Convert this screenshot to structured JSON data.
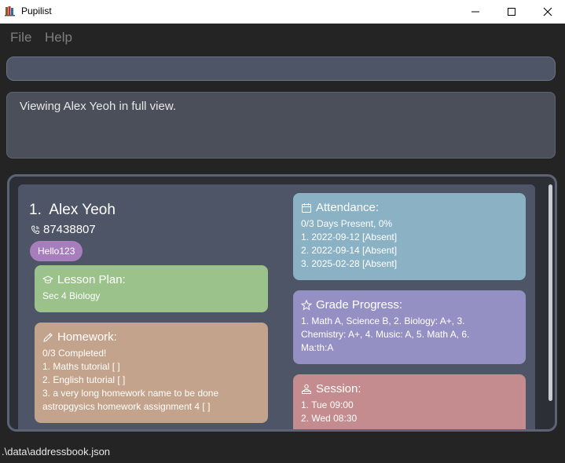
{
  "window": {
    "title": "Pupilist",
    "icon": "books-app-icon"
  },
  "menu": {
    "items": [
      "File",
      "Help"
    ]
  },
  "command_box": {
    "value": ""
  },
  "result_display": {
    "text": "Viewing Alex Yeoh in full view."
  },
  "person": {
    "index": "1.",
    "name": "Alex Yeoh",
    "phone": "87438807",
    "tags": [
      "Hello123"
    ],
    "lesson_plan": {
      "title": "Lesson Plan:",
      "value": "Sec 4 Biology"
    },
    "homework": {
      "title": "Homework:",
      "lines": [
        "0/3 Completed!",
        "1. Maths tutorial [ ]",
        "2. English tutorial [ ]",
        "3. a very long homework name to be done",
        "astropgysics homework assignment 4 [ ]"
      ]
    },
    "attendance": {
      "title": "Attendance:",
      "lines": [
        "0/3 Days Present, 0%",
        "1. 2022-09-12 [Absent]",
        "2. 2022-09-14 [Absent]",
        "3. 2025-02-28 [Absent]"
      ]
    },
    "grade_progress": {
      "title": "Grade Progress:",
      "lines": [
        "1. Math A, Science B, 2. Biology: A+, 3.",
        "Chemistry: A+, 4. Music: A, 5. Math A, 6.",
        "Ma:th:A"
      ]
    },
    "session": {
      "title": "Session:",
      "lines": [
        "1. Tue 09:00",
        "2. Wed 08:30"
      ]
    }
  },
  "status_bar": {
    "path": ".\\data\\addressbook.json"
  },
  "colors": {
    "lesson_plan": "#9cc28c",
    "homework": "#c3a38b",
    "attendance": "#8ab2c4",
    "grade_progress": "#9590c4",
    "session": "#c48c8f",
    "tag": "#a67ebc"
  }
}
